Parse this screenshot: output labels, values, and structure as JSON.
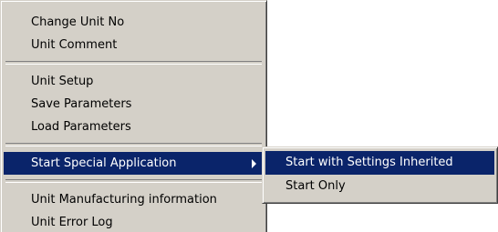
{
  "context_menu": {
    "groups": [
      [
        "Change Unit No",
        "Unit Comment"
      ],
      [
        "Unit Setup",
        "Save Parameters",
        "Load Parameters"
      ],
      [
        "Start Special Application"
      ],
      [
        "Unit Manufacturing information",
        "Unit Error Log"
      ]
    ]
  },
  "submenu": {
    "items": [
      "Start with Settings Inherited",
      "Start Only"
    ]
  },
  "colors": {
    "menu_background": "#d4d0c8",
    "highlight": "#0a246a",
    "highlight_text": "#ffffff"
  },
  "icons": {
    "submenu_arrow": "chevron-right-icon"
  }
}
